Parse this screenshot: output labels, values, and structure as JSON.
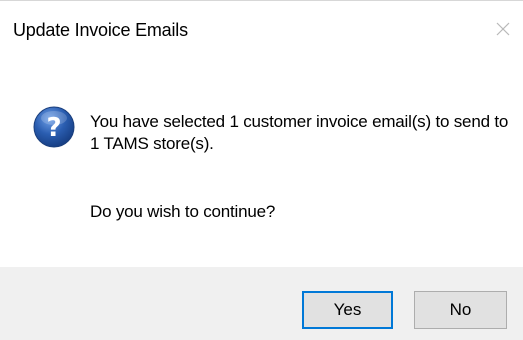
{
  "window": {
    "title": "Update Invoice Emails",
    "close_glyph": "X"
  },
  "message": {
    "icon": "question-icon",
    "text": "You have selected 1 customer invoice email(s) to send to 1 TAMS store(s).",
    "prompt": "Do you wish to continue?"
  },
  "buttons": {
    "yes_label": "Yes",
    "no_label": "No"
  },
  "colors": {
    "focus_border": "#0078d7",
    "button_bar": "#f0f0f0",
    "icon_blue": "#2a5db0"
  }
}
